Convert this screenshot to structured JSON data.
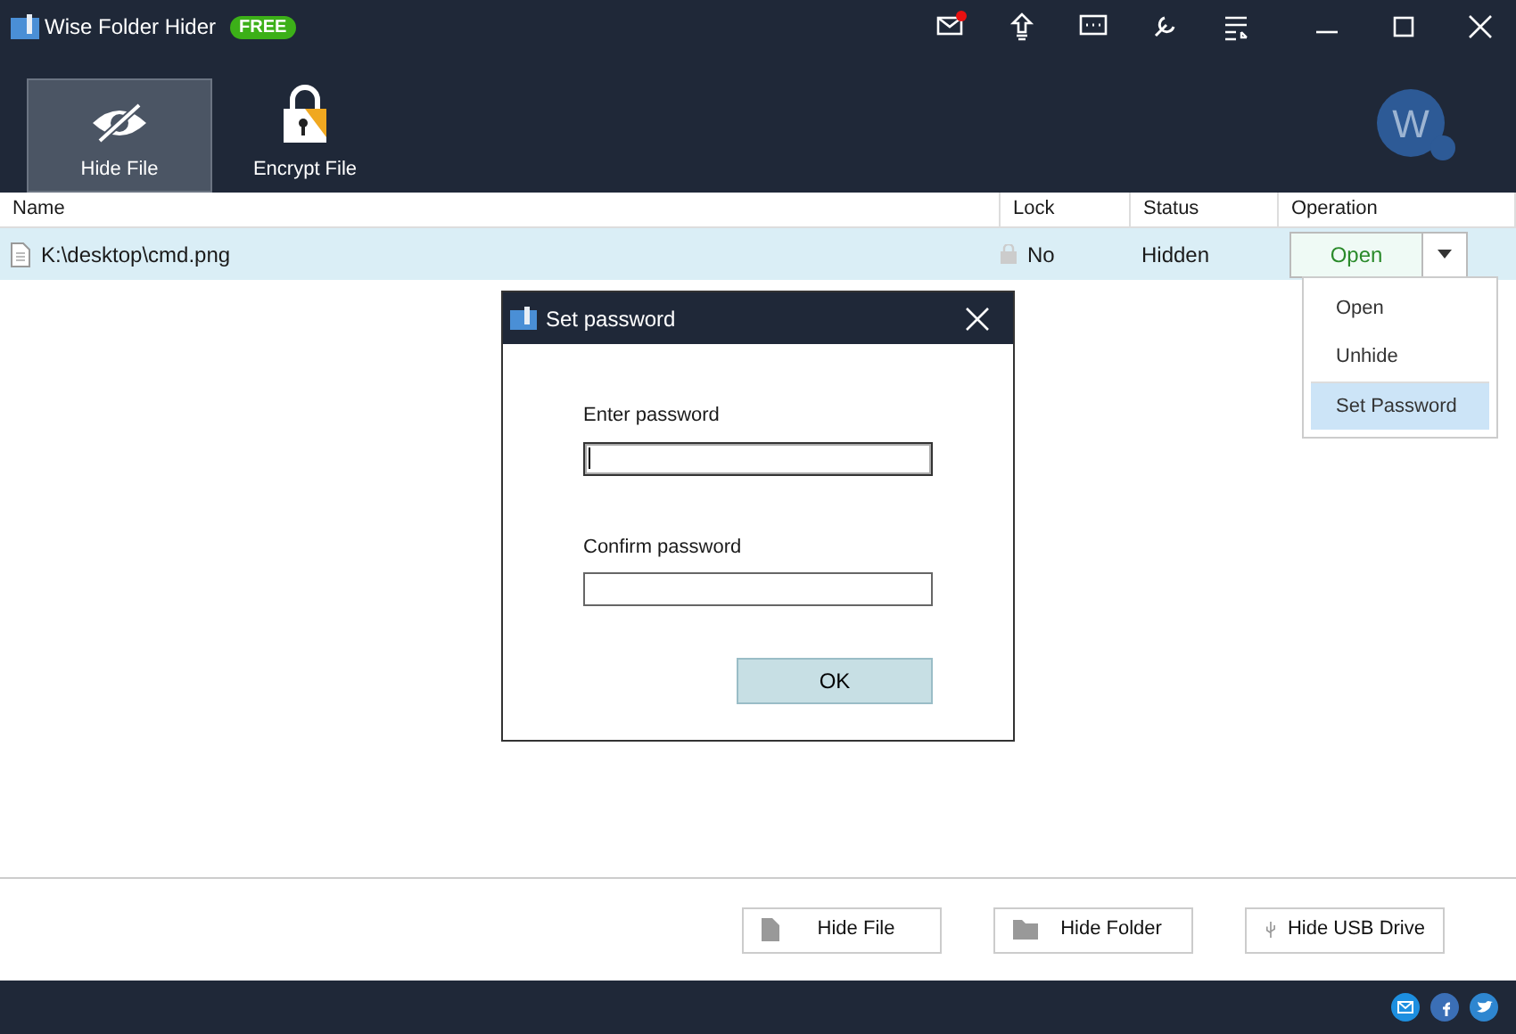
{
  "window": {
    "title": "Wise Folder Hider",
    "badge": "FREE",
    "mail_unread": true
  },
  "tabs": [
    {
      "label": "Hide File",
      "kind": "eye",
      "selected": true
    },
    {
      "label": "Encrypt File",
      "kind": "lock",
      "selected": false
    }
  ],
  "avatar": {
    "letter": "W"
  },
  "table": {
    "columns": [
      "Name",
      "Lock",
      "Status",
      "Operation"
    ],
    "rows": [
      {
        "name": "K:\\desktop\\cmd.png",
        "lock": "No",
        "status": "Hidden",
        "operation": "Open",
        "selected": true
      }
    ]
  },
  "operation_menu": {
    "items": [
      {
        "label": "Open",
        "selected": false
      },
      {
        "label": "Unhide",
        "selected": false
      },
      {
        "label": "Set Password",
        "selected": true
      }
    ]
  },
  "dialog": {
    "title": "Set password",
    "fields": [
      {
        "label": "Enter password",
        "focused": true
      },
      {
        "label": "Confirm password",
        "focused": false
      }
    ],
    "button": "OK"
  },
  "bottom_buttons": [
    {
      "label": "Hide File",
      "kind": "file"
    },
    {
      "label": "Hide Folder",
      "kind": "folder"
    },
    {
      "label": "Hide USB Drive",
      "kind": "usb"
    }
  ]
}
